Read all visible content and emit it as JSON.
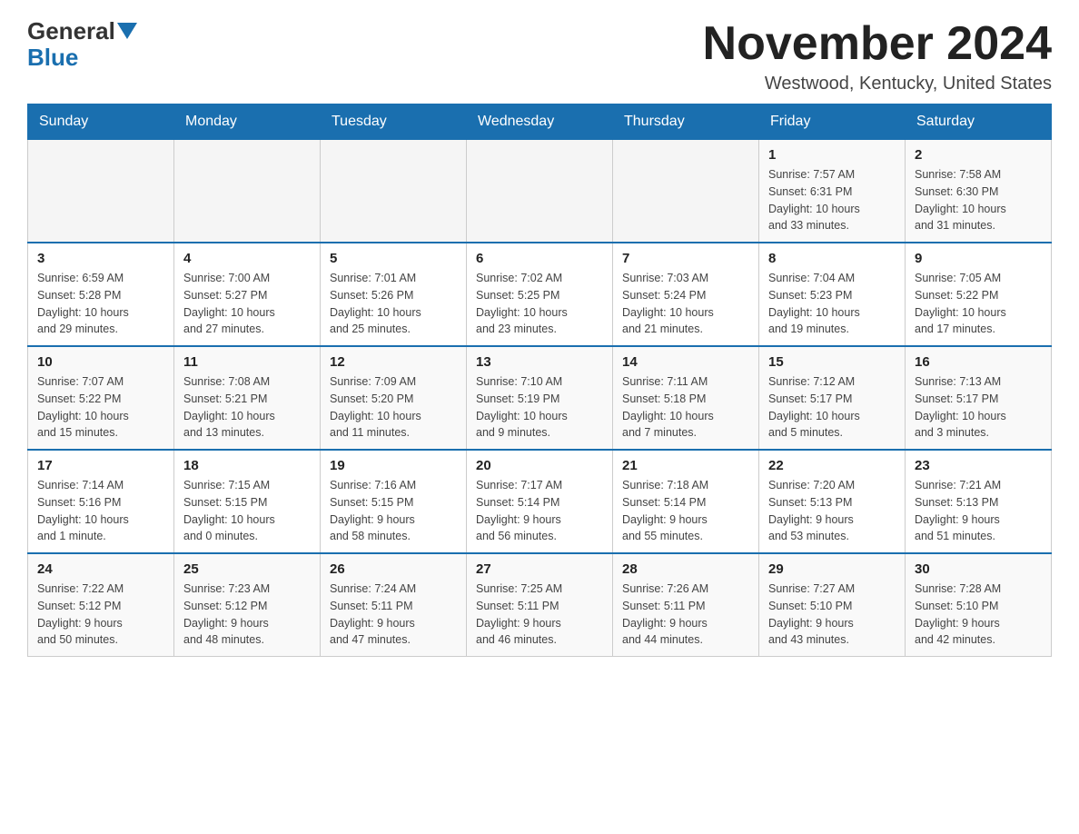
{
  "logo": {
    "general": "General",
    "blue": "Blue"
  },
  "title": "November 2024",
  "location": "Westwood, Kentucky, United States",
  "weekdays": [
    "Sunday",
    "Monday",
    "Tuesday",
    "Wednesday",
    "Thursday",
    "Friday",
    "Saturday"
  ],
  "weeks": [
    [
      {
        "day": "",
        "info": ""
      },
      {
        "day": "",
        "info": ""
      },
      {
        "day": "",
        "info": ""
      },
      {
        "day": "",
        "info": ""
      },
      {
        "day": "",
        "info": ""
      },
      {
        "day": "1",
        "info": "Sunrise: 7:57 AM\nSunset: 6:31 PM\nDaylight: 10 hours\nand 33 minutes."
      },
      {
        "day": "2",
        "info": "Sunrise: 7:58 AM\nSunset: 6:30 PM\nDaylight: 10 hours\nand 31 minutes."
      }
    ],
    [
      {
        "day": "3",
        "info": "Sunrise: 6:59 AM\nSunset: 5:28 PM\nDaylight: 10 hours\nand 29 minutes."
      },
      {
        "day": "4",
        "info": "Sunrise: 7:00 AM\nSunset: 5:27 PM\nDaylight: 10 hours\nand 27 minutes."
      },
      {
        "day": "5",
        "info": "Sunrise: 7:01 AM\nSunset: 5:26 PM\nDaylight: 10 hours\nand 25 minutes."
      },
      {
        "day": "6",
        "info": "Sunrise: 7:02 AM\nSunset: 5:25 PM\nDaylight: 10 hours\nand 23 minutes."
      },
      {
        "day": "7",
        "info": "Sunrise: 7:03 AM\nSunset: 5:24 PM\nDaylight: 10 hours\nand 21 minutes."
      },
      {
        "day": "8",
        "info": "Sunrise: 7:04 AM\nSunset: 5:23 PM\nDaylight: 10 hours\nand 19 minutes."
      },
      {
        "day": "9",
        "info": "Sunrise: 7:05 AM\nSunset: 5:22 PM\nDaylight: 10 hours\nand 17 minutes."
      }
    ],
    [
      {
        "day": "10",
        "info": "Sunrise: 7:07 AM\nSunset: 5:22 PM\nDaylight: 10 hours\nand 15 minutes."
      },
      {
        "day": "11",
        "info": "Sunrise: 7:08 AM\nSunset: 5:21 PM\nDaylight: 10 hours\nand 13 minutes."
      },
      {
        "day": "12",
        "info": "Sunrise: 7:09 AM\nSunset: 5:20 PM\nDaylight: 10 hours\nand 11 minutes."
      },
      {
        "day": "13",
        "info": "Sunrise: 7:10 AM\nSunset: 5:19 PM\nDaylight: 10 hours\nand 9 minutes."
      },
      {
        "day": "14",
        "info": "Sunrise: 7:11 AM\nSunset: 5:18 PM\nDaylight: 10 hours\nand 7 minutes."
      },
      {
        "day": "15",
        "info": "Sunrise: 7:12 AM\nSunset: 5:17 PM\nDaylight: 10 hours\nand 5 minutes."
      },
      {
        "day": "16",
        "info": "Sunrise: 7:13 AM\nSunset: 5:17 PM\nDaylight: 10 hours\nand 3 minutes."
      }
    ],
    [
      {
        "day": "17",
        "info": "Sunrise: 7:14 AM\nSunset: 5:16 PM\nDaylight: 10 hours\nand 1 minute."
      },
      {
        "day": "18",
        "info": "Sunrise: 7:15 AM\nSunset: 5:15 PM\nDaylight: 10 hours\nand 0 minutes."
      },
      {
        "day": "19",
        "info": "Sunrise: 7:16 AM\nSunset: 5:15 PM\nDaylight: 9 hours\nand 58 minutes."
      },
      {
        "day": "20",
        "info": "Sunrise: 7:17 AM\nSunset: 5:14 PM\nDaylight: 9 hours\nand 56 minutes."
      },
      {
        "day": "21",
        "info": "Sunrise: 7:18 AM\nSunset: 5:14 PM\nDaylight: 9 hours\nand 55 minutes."
      },
      {
        "day": "22",
        "info": "Sunrise: 7:20 AM\nSunset: 5:13 PM\nDaylight: 9 hours\nand 53 minutes."
      },
      {
        "day": "23",
        "info": "Sunrise: 7:21 AM\nSunset: 5:13 PM\nDaylight: 9 hours\nand 51 minutes."
      }
    ],
    [
      {
        "day": "24",
        "info": "Sunrise: 7:22 AM\nSunset: 5:12 PM\nDaylight: 9 hours\nand 50 minutes."
      },
      {
        "day": "25",
        "info": "Sunrise: 7:23 AM\nSunset: 5:12 PM\nDaylight: 9 hours\nand 48 minutes."
      },
      {
        "day": "26",
        "info": "Sunrise: 7:24 AM\nSunset: 5:11 PM\nDaylight: 9 hours\nand 47 minutes."
      },
      {
        "day": "27",
        "info": "Sunrise: 7:25 AM\nSunset: 5:11 PM\nDaylight: 9 hours\nand 46 minutes."
      },
      {
        "day": "28",
        "info": "Sunrise: 7:26 AM\nSunset: 5:11 PM\nDaylight: 9 hours\nand 44 minutes."
      },
      {
        "day": "29",
        "info": "Sunrise: 7:27 AM\nSunset: 5:10 PM\nDaylight: 9 hours\nand 43 minutes."
      },
      {
        "day": "30",
        "info": "Sunrise: 7:28 AM\nSunset: 5:10 PM\nDaylight: 9 hours\nand 42 minutes."
      }
    ]
  ]
}
